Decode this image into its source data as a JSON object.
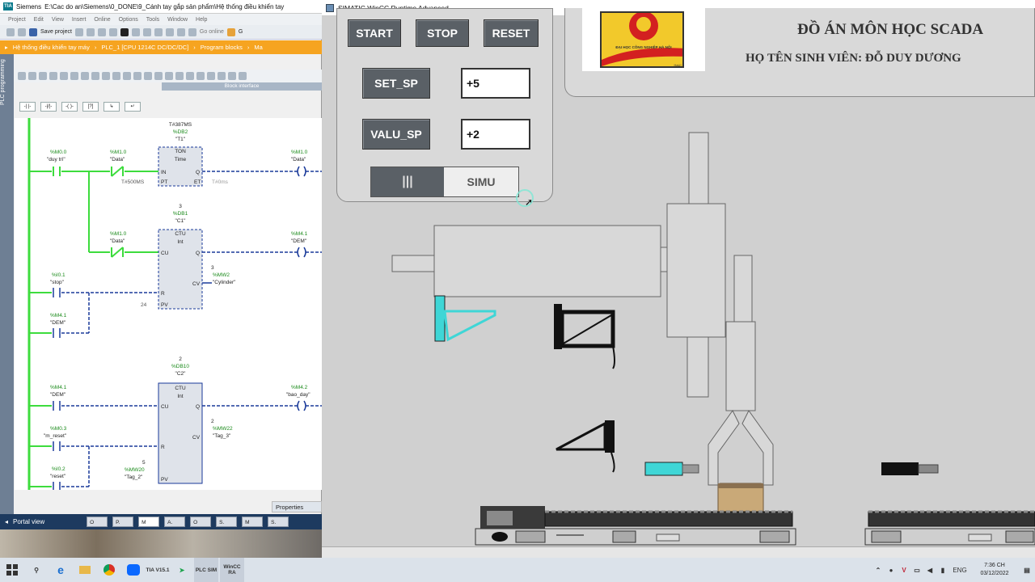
{
  "tia": {
    "app_name": "Siemens",
    "title_path": "E:\\Cac do an\\Siemens\\0_DONE\\9_Cánh tay gắp sản phẩm\\Hệ thống điều khiển tay",
    "menu": [
      "Project",
      "Edit",
      "View",
      "Insert",
      "Online",
      "Options",
      "Tools",
      "Window",
      "Help"
    ],
    "save_project": "Save project",
    "go_online": "Go online",
    "go_offline": "G",
    "breadcrumb": [
      "Hệ thống điều khiển tay máy",
      "PLC_1 [CPU 1214C DC/DC/DC]",
      "Program blocks",
      "Ma"
    ],
    "sidebar_tab": "PLC programming",
    "block_interface": "Block interface",
    "properties": "Properties",
    "portal_view": "Portal view",
    "portal_tabs": [
      "O",
      "P.",
      "M",
      "A.",
      "O",
      "S.",
      "M",
      "S."
    ],
    "network": {
      "t1_preset_top": "T#387MS",
      "t1_db": "%DB2",
      "t1_name": "\"T1\"",
      "ton": "TON",
      "time": "Time",
      "in": "IN",
      "pt": "PT",
      "q": "Q",
      "et": "ET",
      "pt_value": "T#500MS",
      "et_value": "T#0ms",
      "m00": "%M0.0",
      "m00_name": "\"duy trì\"",
      "m10a": "%M1.0",
      "m10a_name": "\"Data\"",
      "m10out": "%M1.0",
      "m10out_name": "\"Data\"",
      "c1_count": "3",
      "c1_db": "%DB1",
      "c1_name": "\"C1\"",
      "ctu": "CTU",
      "int": "Int",
      "cu": "CU",
      "r": "R",
      "pv": "PV",
      "cv": "CV",
      "m10b": "%M1.0",
      "m10b_name": "\"Data\"",
      "m41out": "%M4.1",
      "m41out_name": "\"DEM\"",
      "i01": "%I0.1",
      "i01_name": "\"stop\"",
      "mw2_val": "3",
      "mw2": "%MW2",
      "mw2_name": "\"Cylinder\"",
      "pv_24": "24",
      "m41a": "%M4.1",
      "m41a_name": "\"DEM\"",
      "c2_count": "2",
      "c2_db": "%DB10",
      "c2_name": "\"C2\"",
      "m41b": "%M4.1",
      "m41b_name": "\"DEM\"",
      "m42out": "%M4.2",
      "m42out_name": "\"bao_day\"",
      "m03": "%M0.3",
      "m03_name": "\"m_reset\"",
      "mw22_val": "2",
      "mw22": "%MW22",
      "mw22_name": "\"Tag_3\"",
      "i02": "%I0.2",
      "i02_name": "\"reset\"",
      "mw20_val": "5",
      "mw20": "%MW20",
      "mw20_name": "\"Tag_2\""
    }
  },
  "wincc": {
    "title": "SIMATIC WinCC Runtime Advanced",
    "start": "START",
    "stop": "STOP",
    "reset": "RESET",
    "set_sp_label": "SET_SP",
    "set_sp_value": "+5",
    "valu_sp_label": "VALU_SP",
    "valu_sp_value": "+2",
    "toggle_off_glyph": "|||",
    "simu": "SIMU",
    "logo_text": "ĐẠI HỌC CÔNG NGHIỆP HÀ NỘI",
    "logo_corner": "HaUI",
    "title_main": "ĐỒ ÁN MÔN HỌC SCADA",
    "title_sub": "HỌ TÊN SINH VIÊN: ĐỖ DUY DƯƠNG"
  },
  "taskbar": {
    "apps": [
      "TIA V15.1",
      "PLC SIM",
      "WinCC RA"
    ],
    "lang": "ENG",
    "time": "7:36 CH",
    "date": "03/12/2022"
  },
  "colors": {
    "tia_orange": "#f6a420",
    "ladder_green": "#3ddc3d",
    "ladder_blue": "#1a3a9a",
    "wincc_button": "#5a6066",
    "sensor_cyan": "#3fd6d6"
  }
}
